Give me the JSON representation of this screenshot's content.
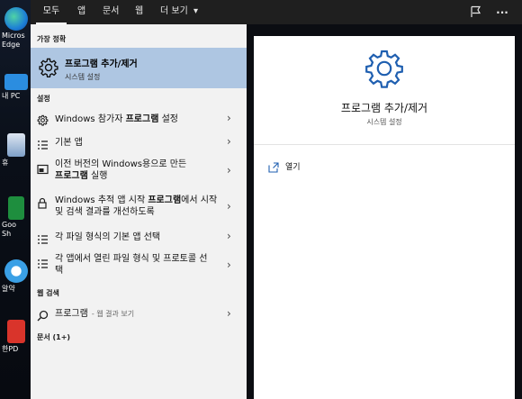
{
  "desktop": {
    "icons": [
      {
        "label": "Micros",
        "label2": "Edge",
        "color": "#1d7fd6"
      },
      {
        "label": "내 PC",
        "color": "#2b8de0"
      },
      {
        "label": "휴",
        "color": "#7ea0c8"
      },
      {
        "label": "Goo",
        "label2": "Sh",
        "color": "#1e8e3e"
      },
      {
        "label": "알약",
        "color": "#3aa0e6"
      },
      {
        "label": "한PD",
        "color": "#d9342b"
      }
    ]
  },
  "topbar": {
    "tabs": [
      "모두",
      "앱",
      "문서",
      "웹",
      "더 보기"
    ],
    "more_arrow": "▾",
    "feedback_icon": "feedback-icon",
    "more_options": "···"
  },
  "left": {
    "best_match_header": "가장 정확",
    "best_match": {
      "title": "프로그램 추가/제거",
      "subtitle": "시스템 설정",
      "icon": "gear-icon"
    },
    "settings_header": "설정",
    "settings": [
      {
        "pre": "Windows 참가자 ",
        "bold": "프로그램",
        "post": " 설정",
        "icon": "gear-icon"
      },
      {
        "pre": "기본 앱",
        "bold": "",
        "post": "",
        "icon": "list-icon"
      },
      {
        "pre": "이전 버전의 Windows용으로 만든",
        "bold": "프로그램",
        "post": " 실행",
        "icon": "window-icon"
      },
      {
        "pre": "Windows 추적 앱 시작 ",
        "bold": "프로그램",
        "post": "에서 시작 및 검색 결과를 개선하도록",
        "icon": "lock-icon"
      },
      {
        "pre": "각 파일 형식의 기본 앱 선택",
        "bold": "",
        "post": "",
        "icon": "list-icon"
      },
      {
        "pre": "각 앱에서 열린 파일 형식 및 프로토콜 선택",
        "bold": "",
        "post": "",
        "icon": "list-icon"
      }
    ],
    "web_header": "웹 검색",
    "web": {
      "query": "프로그램",
      "hint": "- 웹 결과 보기",
      "icon": "search-icon"
    },
    "docs_header": "문서 (1+)"
  },
  "right": {
    "title": "프로그램 추가/제거",
    "subtitle": "시스템 설정",
    "open_label": "열기",
    "icon": "gear-icon"
  },
  "colors": {
    "topbar": "#1f1f1f",
    "left_bg": "#f2f2f2",
    "highlight": "#aec6e2",
    "accent": "#1f5fb0"
  }
}
